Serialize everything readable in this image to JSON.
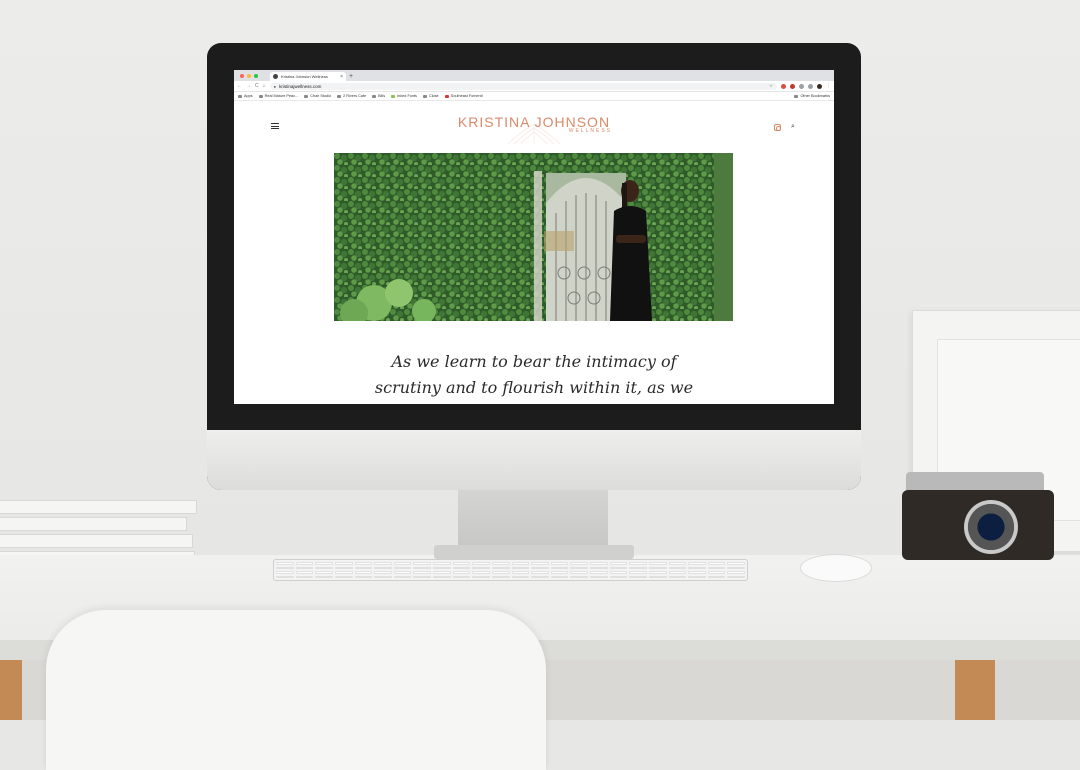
{
  "browser": {
    "tab_title": "Kristina Johnson Wellness",
    "tab_close": "×",
    "new_tab": "+",
    "url": "kristinajwellness.com",
    "nav": {
      "back": "←",
      "forward": "→",
      "reload": "C",
      "home": "⌂"
    },
    "bookmarks": [
      "Apps",
      "Real Mature Peac...",
      "Chair Studio",
      "2 Rivers Cafe",
      "Bills",
      "Inked Fonts",
      "Close",
      "Southeast Fomentl"
    ],
    "other_bookmarks": "Other Bookmarks",
    "traffic_colors": [
      "#ff5f57",
      "#febc2e",
      "#28c840"
    ]
  },
  "site": {
    "brand_name": "KRISTINA JOHNSON",
    "brand_sub": "WELLNESS",
    "brand_color": "#d98a68",
    "menu_icon": "hamburger-menu-icon",
    "social_icon": "instagram-icon",
    "search_icon": "search-icon",
    "search_glyph": "⌕",
    "quote_line1": "As we learn to bear the intimacy of",
    "quote_line2": "scrutiny and to flourish within it, as we"
  }
}
